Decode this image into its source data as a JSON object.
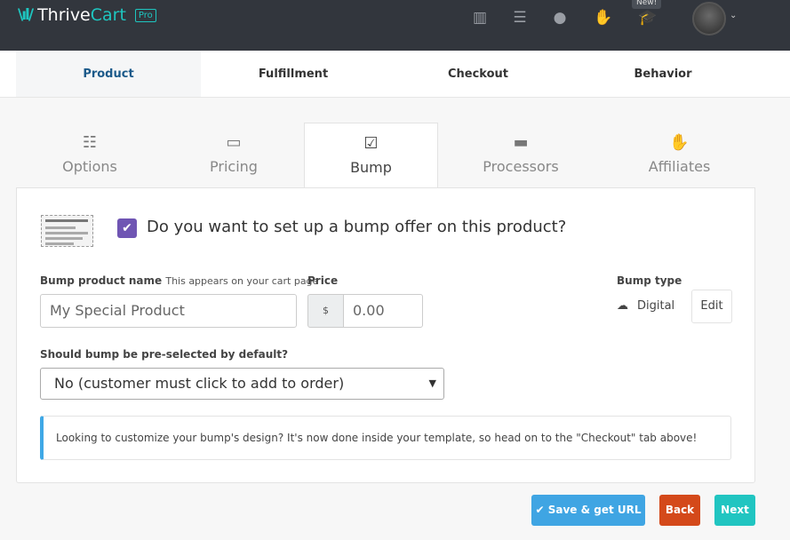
{
  "header": {
    "logo_main": "Thrive",
    "logo_accent": "Cart",
    "logo_badge": "Pro",
    "new_badge": "New!",
    "icons": [
      "columns-icon",
      "list-icon",
      "user-icon",
      "handshake-icon",
      "graduation-cap-icon"
    ]
  },
  "top_tabs": [
    {
      "label": "Product",
      "active": true
    },
    {
      "label": "Fulfillment"
    },
    {
      "label": "Checkout"
    },
    {
      "label": "Behavior"
    }
  ],
  "sub_tabs": [
    {
      "label": "Options",
      "icon": "sliders-icon"
    },
    {
      "label": "Pricing",
      "icon": "money-icon"
    },
    {
      "label": "Bump",
      "icon": "checkbox-icon",
      "active": true
    },
    {
      "label": "Processors",
      "icon": "credit-card-icon"
    },
    {
      "label": "Affiliates",
      "icon": "handshake-icon"
    }
  ],
  "bump": {
    "question": "Do you want to set up a bump offer on this product?",
    "enabled": true,
    "name_label": "Bump product name",
    "name_hint": "This appears on your cart page",
    "name_placeholder": "My Special Product",
    "price_label": "Price",
    "currency": "$",
    "price_placeholder": "0.00",
    "type_label": "Bump type",
    "type_value": "Digital",
    "edit_label": "Edit",
    "preselect_label": "Should bump be pre-selected by default?",
    "preselect_value": "No (customer must click to add to order)",
    "info": "Looking to customize your bump's design? It's now done inside your template, so head on to the \"Checkout\" tab above!"
  },
  "actions": {
    "save": "Save & get URL",
    "back": "Back",
    "next": "Next"
  },
  "colors": {
    "header": "#32363d",
    "accent": "#1ec6c0",
    "checkbox": "#6f55b3",
    "save": "#3fa5e3",
    "back": "#d4491a",
    "next": "#20c5c1"
  }
}
